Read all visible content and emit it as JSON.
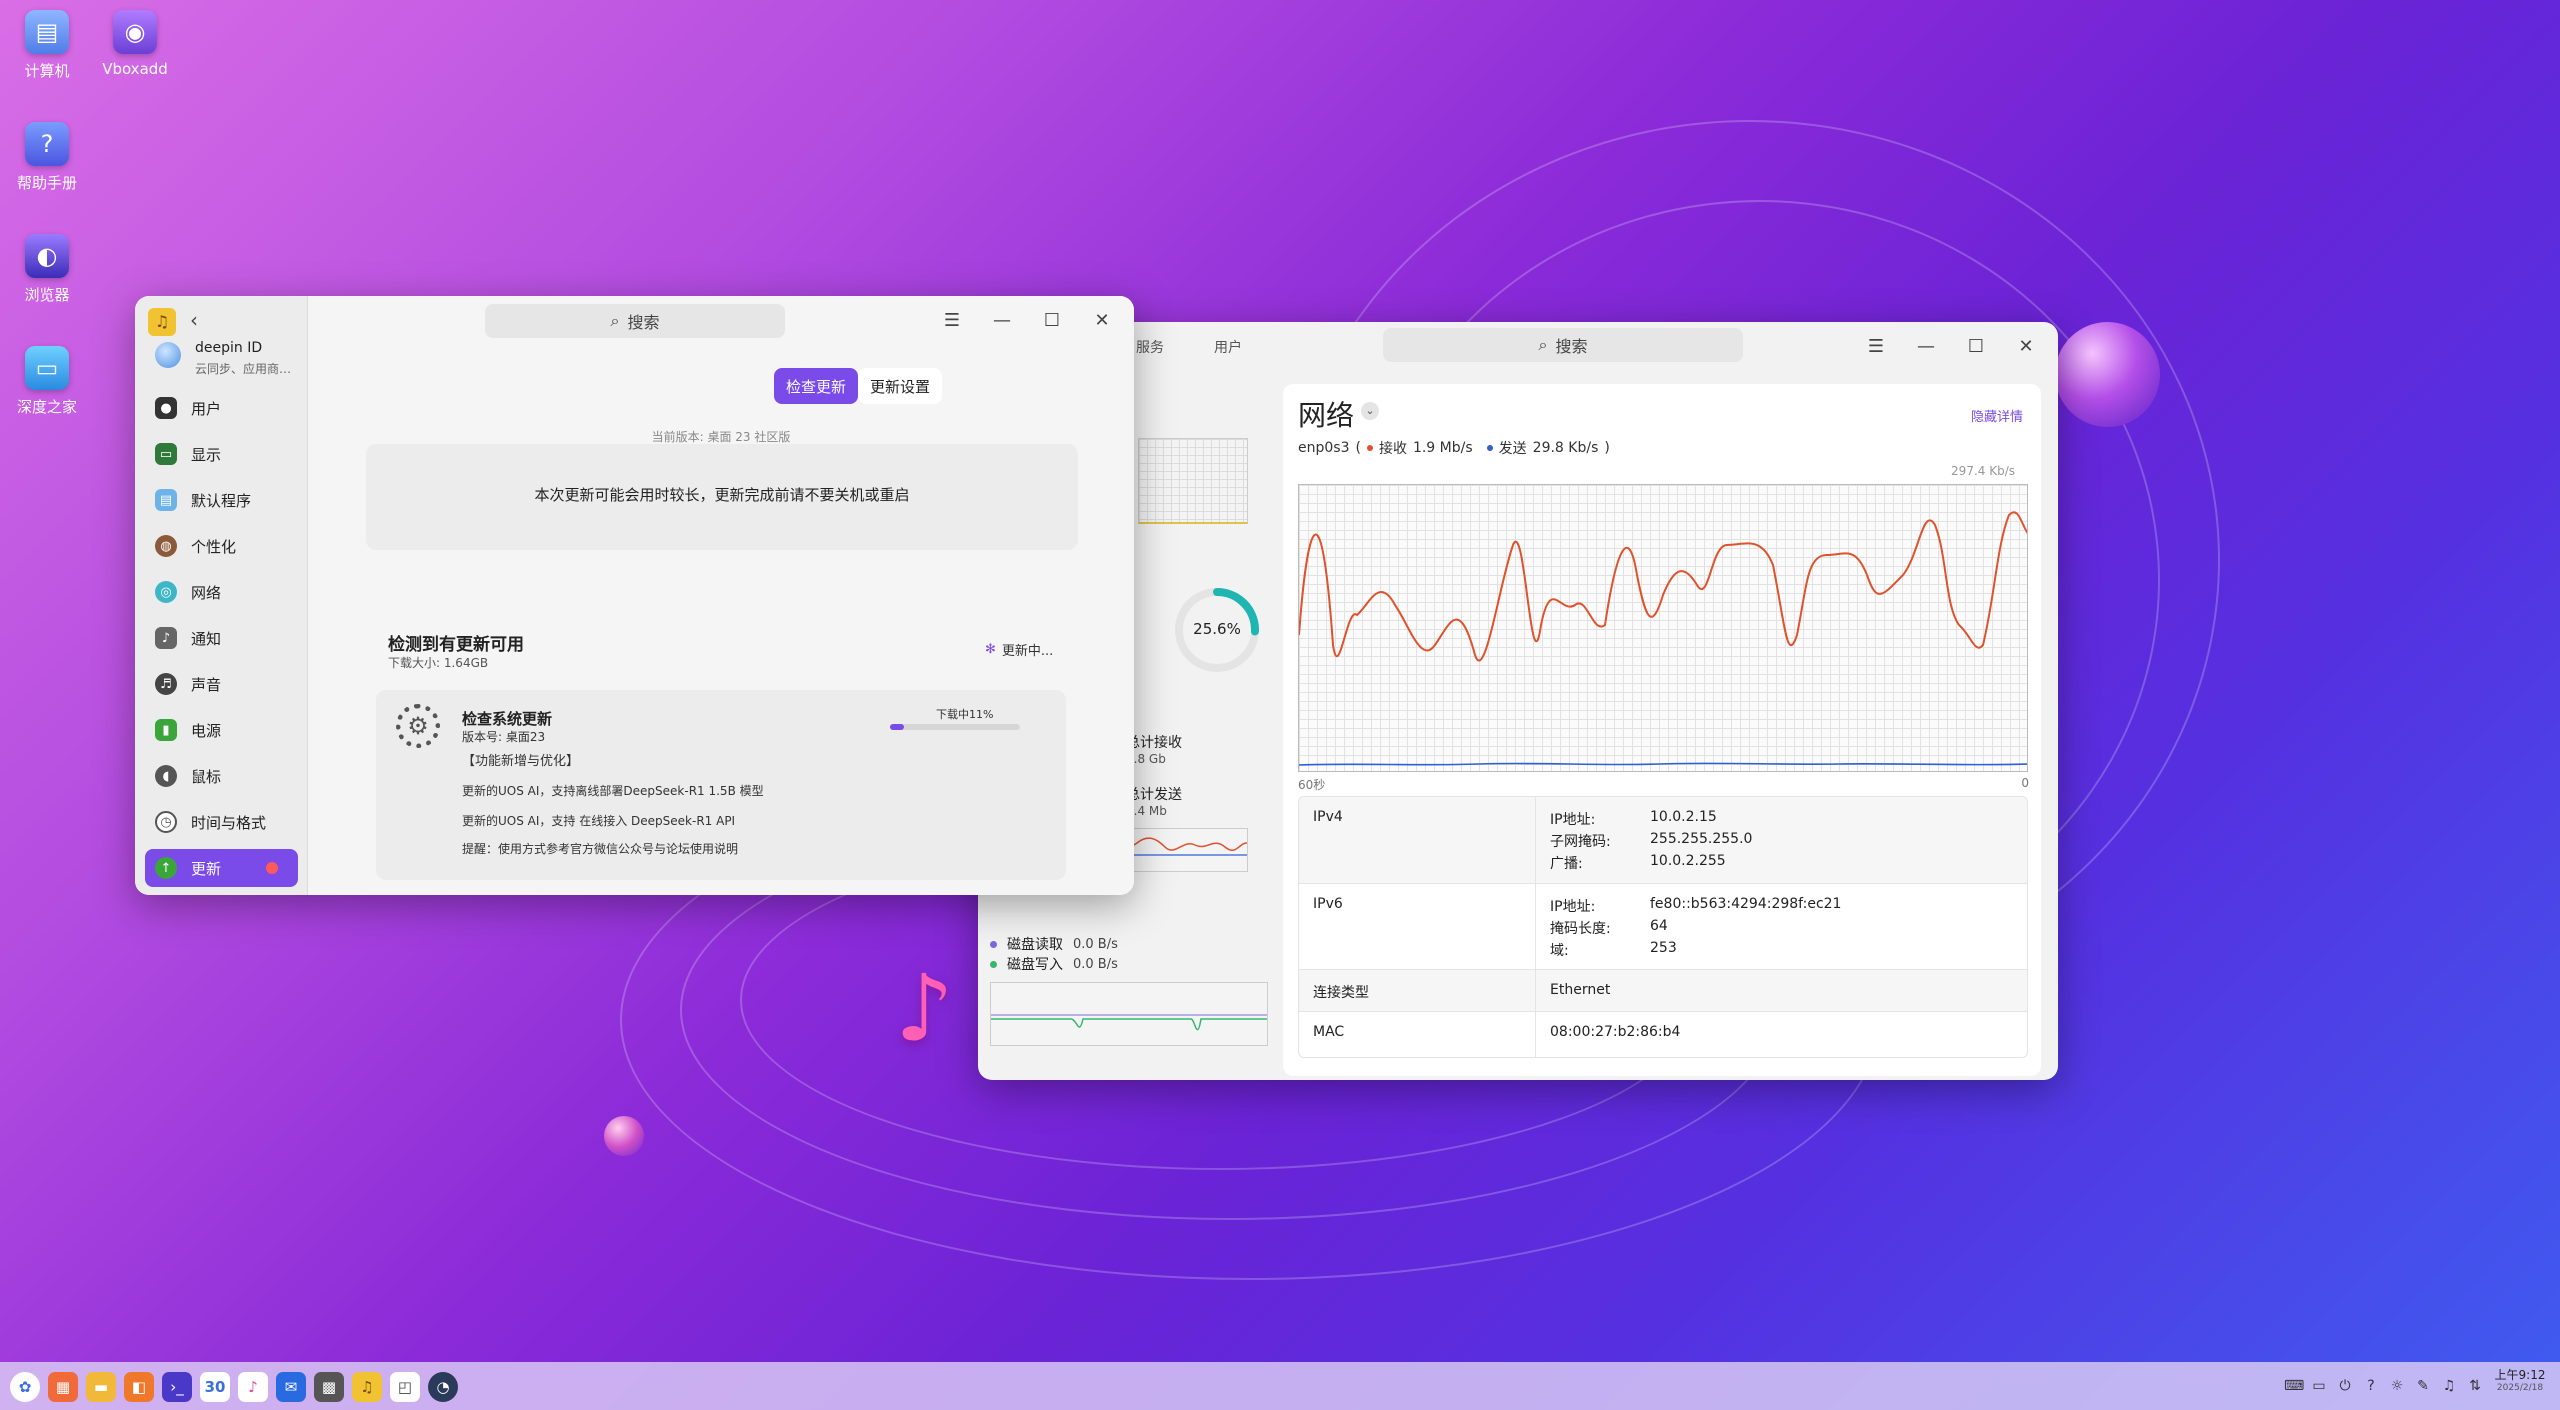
{
  "desktop": {
    "icons": [
      {
        "label": "计算机",
        "icon": "computer-icon"
      },
      {
        "label": "Vboxadd",
        "icon": "vbox-disc-icon"
      },
      {
        "label": "帮助手册",
        "icon": "help-manual-icon"
      },
      {
        "label": "浏览器",
        "icon": "browser-icon"
      },
      {
        "label": "深度之家",
        "icon": "deepin-home-icon"
      }
    ]
  },
  "control_center": {
    "search_placeholder": "搜索",
    "account": {
      "name": "deepin ID",
      "sub": "云同步、应用商…"
    },
    "sidebar": [
      {
        "label": "用户"
      },
      {
        "label": "显示"
      },
      {
        "label": "默认程序"
      },
      {
        "label": "个性化"
      },
      {
        "label": "网络"
      },
      {
        "label": "通知"
      },
      {
        "label": "声音"
      },
      {
        "label": "电源"
      },
      {
        "label": "鼠标"
      },
      {
        "label": "时间与格式"
      },
      {
        "label": "更新"
      }
    ],
    "tabs": {
      "check": "检查更新",
      "settings": "更新设置"
    },
    "current_version": "当前版本: 桌面 23 社区版",
    "notice": "本次更新可能会用时较长，更新完成前请不要关机或重启",
    "available_title": "检测到有更新可用",
    "download_size": "下载大小: 1.64GB",
    "updating_text": "更新中...",
    "update_item": {
      "title": "检查系统更新",
      "version": "版本号: 桌面23",
      "progress_label": "下载中11%",
      "progress": 0.11,
      "lines": [
        "【功能新增与优化】",
        "更新的UOS AI，支持离线部署DeepSeek-R1 1.5B 模型",
        "更新的UOS AI，支持 在线接入 DeepSeek-R1 API",
        "提醒：使用方式参考官方微信公众号与论坛使用说明"
      ]
    }
  },
  "monitor": {
    "tabs": [
      "服务",
      "用户"
    ],
    "search_placeholder": "搜索",
    "cpu_percent": "25.6%",
    "cpu_value": 0.256,
    "total_recv_label": "总计接收",
    "total_recv_value": "1.8 Gb",
    "total_send_label": "总计发送",
    "total_send_value": "2.4 Mb",
    "disk_read_label": "磁盘读取",
    "disk_read_value": "0.0 B/s",
    "disk_write_label": "磁盘写入",
    "disk_write_value": "0.0 B/s",
    "network": {
      "title": "网络",
      "hide_details": "隐藏详情",
      "iface": "enp0s3",
      "recv_label": "接收",
      "recv_value": "1.9 Mb/s",
      "send_label": "发送",
      "send_value": "29.8 Kb/s",
      "max_label": "297.4 Kb/s",
      "x_left": "60秒",
      "x_right": "0",
      "colors": {
        "recv": "#e0522b",
        "send": "#2f5fd6"
      },
      "info": [
        {
          "key": "IPv4",
          "rows": [
            {
              "k": "IP地址:",
              "v": "10.0.2.15"
            },
            {
              "k": "子网掩码:",
              "v": "255.255.255.0"
            },
            {
              "k": "广播:",
              "v": "10.0.2.255"
            }
          ]
        },
        {
          "key": "IPv6",
          "rows": [
            {
              "k": "IP地址:",
              "v": "fe80::b563:4294:298f:ec21"
            },
            {
              "k": "掩码长度:",
              "v": "64"
            },
            {
              "k": "域:",
              "v": "253"
            }
          ]
        },
        {
          "key": "连接类型",
          "rows": [
            {
              "k": "",
              "v": "Ethernet"
            }
          ]
        },
        {
          "key": "MAC",
          "rows": [
            {
              "k": "",
              "v": "08:00:27:b2:86:b4"
            }
          ]
        }
      ]
    }
  },
  "taskbar": {
    "time": "上午9:12",
    "date": "2025/2/18",
    "calendar_day": "30"
  }
}
